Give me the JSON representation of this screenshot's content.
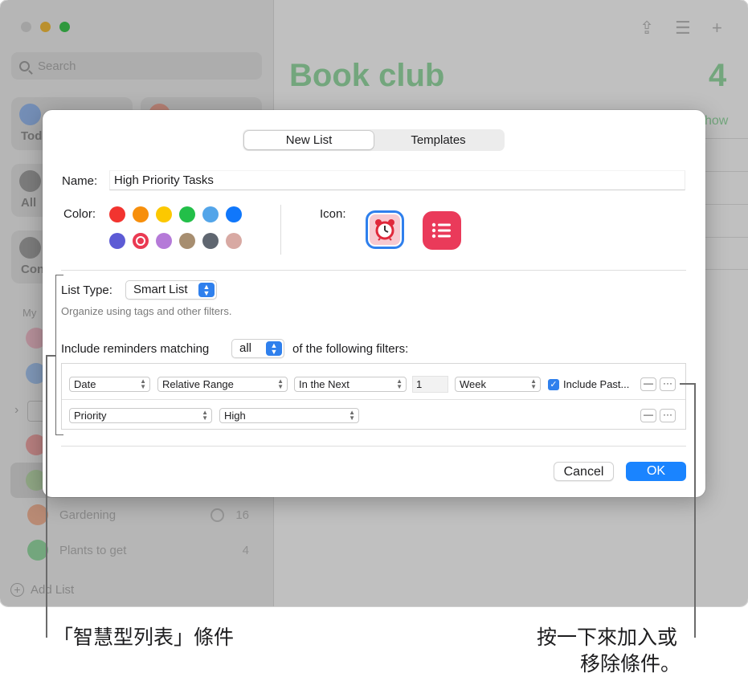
{
  "background_window": {
    "search_placeholder": "Search",
    "smart_tiles": [
      {
        "label": "Tod",
        "color": "#8fb6f0"
      },
      {
        "label": "",
        "color": "#f1a18f"
      },
      {
        "label": "All",
        "color": "#9b9b9b"
      },
      {
        "label": "Con",
        "color": "#9b9b9b"
      }
    ],
    "my_lists_header": "My",
    "lists": [
      {
        "name": "Gardening",
        "count": "16",
        "shared": true,
        "color": "#f3b08f"
      },
      {
        "name": "Plants to get",
        "count": "4",
        "shared": false,
        "color": "#8ed99c"
      }
    ],
    "add_list_label": "Add List",
    "main_title": "Book club",
    "main_count": "4",
    "show_link": "how",
    "accent": "#8ed99c"
  },
  "dialog": {
    "tabs": [
      "New List",
      "Templates"
    ],
    "active_tab": "New List",
    "name_label": "Name:",
    "name_value": "High Priority Tasks",
    "color_label": "Color:",
    "colors_row1": [
      "#f2342f",
      "#f78f0c",
      "#fcc800",
      "#23bf49",
      "#53a5e9",
      "#1077fb"
    ],
    "colors_row2": [
      "#5d5bd5",
      "#ea3a52",
      "#b57ad8",
      "#a78e70",
      "#5f6670",
      "#d8a9a3"
    ],
    "selected_color": "#ea3a52",
    "icon_label": "Icon:",
    "icons": [
      "alarm-clock-icon",
      "bulleted-list-icon"
    ],
    "list_type_label": "List Type:",
    "list_type_value": "Smart List",
    "list_type_hint": "Organize using tags and other filters.",
    "include_label": "Include reminders matching",
    "match_value": "all",
    "following_label": "of the following filters:",
    "filter_row_1": {
      "field": "Date",
      "range": "Relative Range",
      "direction": "In the Next",
      "amount": "1",
      "unit": "Week",
      "include_past_label": "Include Past...",
      "include_past_checked": true
    },
    "filter_row_2": {
      "field": "Priority",
      "value": "High"
    },
    "remove_symbol": "—",
    "more_symbol": "···",
    "cancel_label": "Cancel",
    "ok_label": "OK"
  },
  "callouts": {
    "left": "「智慧型列表」條件",
    "right_line1": "按一下來加入或",
    "right_line2": "移除條件。"
  }
}
